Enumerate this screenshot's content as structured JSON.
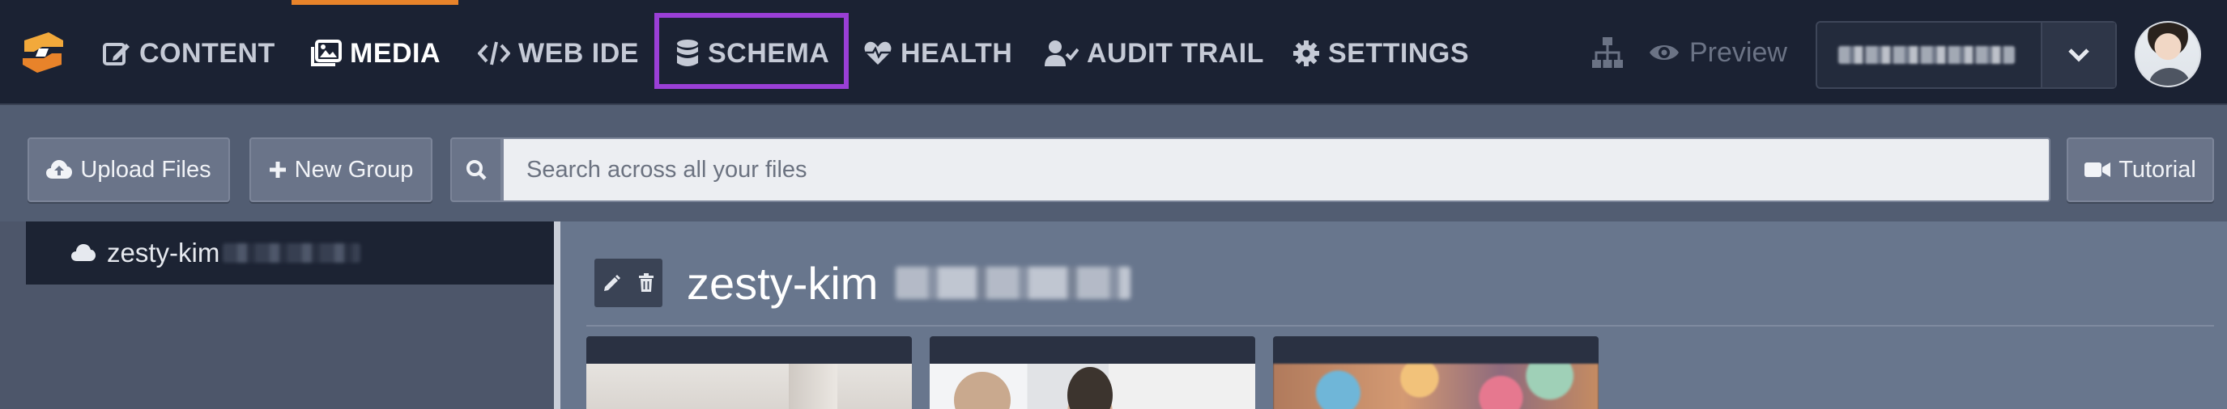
{
  "nav": {
    "items": [
      {
        "label": "CONTENT",
        "icon": "edit-icon"
      },
      {
        "label": "MEDIA",
        "icon": "image-icon"
      },
      {
        "label": "WEB IDE",
        "icon": "code-icon"
      },
      {
        "label": "SCHEMA",
        "icon": "database-icon"
      },
      {
        "label": "HEALTH",
        "icon": "heartbeat-icon"
      },
      {
        "label": "AUDIT TRAIL",
        "icon": "user-check-icon"
      },
      {
        "label": "SETTINGS",
        "icon": "gear-icon"
      }
    ],
    "active_item": "MEDIA",
    "highlighted_item": "SCHEMA",
    "preview_label": "Preview",
    "instance_name_redacted": true,
    "colors": {
      "active_bar": "#e8832a",
      "highlight_box": "#9a3fd6",
      "nav_bg": "#1b2233"
    }
  },
  "toolbar": {
    "upload_label": "Upload Files",
    "new_group_label": "New Group",
    "search_placeholder": "Search across all your files",
    "tutorial_label": "Tutorial"
  },
  "sidebar": {
    "items": [
      {
        "label": "zesty-kim",
        "icon": "cloud-icon",
        "suffix_redacted": true
      }
    ]
  },
  "main": {
    "group_title": "zesty-kim",
    "title_suffix_redacted": true,
    "cards": [
      {
        "thumb": "office-interior"
      },
      {
        "thumb": "people-meeting"
      },
      {
        "thumb": "bokeh-lights"
      }
    ]
  }
}
